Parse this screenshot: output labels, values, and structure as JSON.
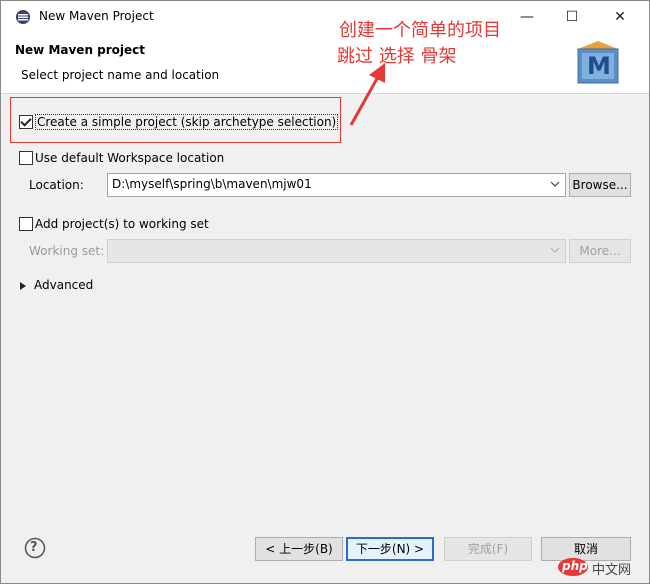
{
  "window": {
    "title": "New Maven Project",
    "minimize_glyph": "—",
    "maximize_glyph": "☐",
    "close_glyph": "✕"
  },
  "header": {
    "title": "New Maven project",
    "subtitle": "Select project name and location",
    "logo_letter": "M"
  },
  "annotation": {
    "line1": "创建一个简单的项目",
    "line2": "跳过 选择 骨架",
    "color": "#e53935"
  },
  "options": {
    "simple_project": {
      "label": "Create a simple project (skip archetype selection)",
      "checked": true
    },
    "default_workspace": {
      "label": "Use default Workspace location",
      "checked": false
    },
    "location_label": "Location:",
    "location_value": "D:\\myself\\spring\\b\\maven\\mjw01",
    "browse_label": "Browse...",
    "working_set_checkbox": {
      "label": "Add project(s) to working set",
      "checked": false
    },
    "working_set_label": "Working set:",
    "working_set_value": "",
    "more_label": "More...",
    "advanced_label": "Advanced"
  },
  "footer": {
    "help_glyph": "?",
    "back_label": "< 上一步(B)",
    "next_label": "下一步(N) >",
    "finish_label": "完成(F)",
    "cancel_label": "取消"
  },
  "watermark": {
    "text1": "php",
    "text2": "中文网"
  }
}
